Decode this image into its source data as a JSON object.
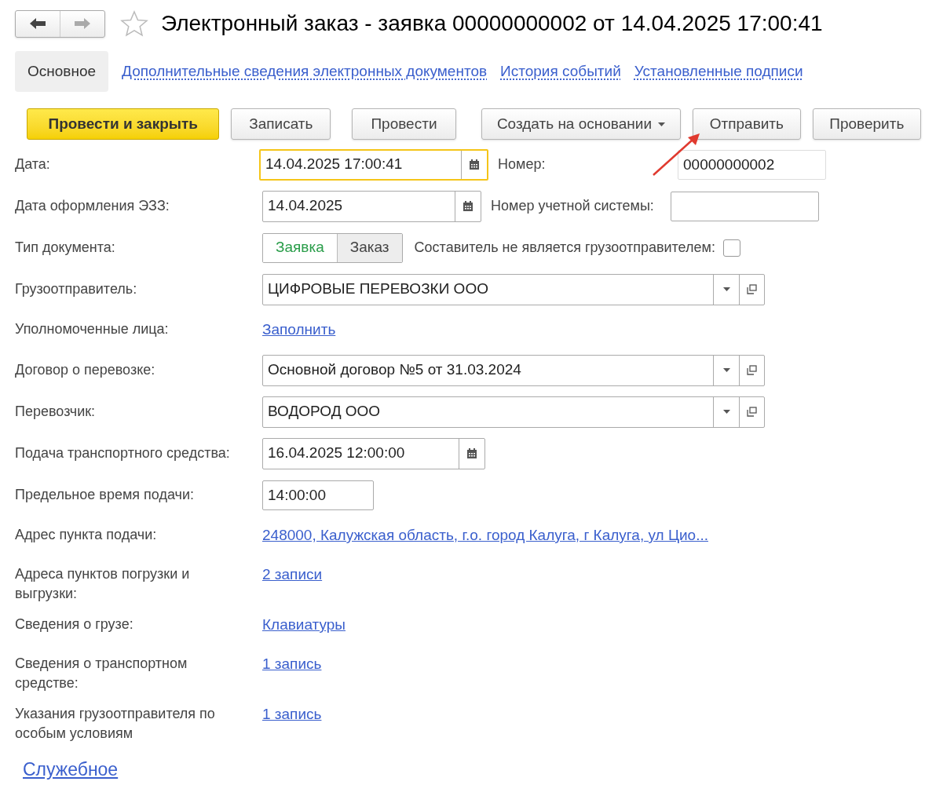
{
  "window": {
    "title": "Электронный заказ - заявка 00000000002 от 14.04.2025 17:00:41",
    "favorite": false
  },
  "tabs": [
    {
      "label": "Основное",
      "selected": true
    },
    {
      "label": "Дополнительные сведения электронных документов",
      "selected": false
    },
    {
      "label": "История событий",
      "selected": false
    },
    {
      "label": "Установленные подписи",
      "selected": false
    }
  ],
  "toolbar": [
    {
      "label": "Провести и закрыть",
      "kind": "primary"
    },
    {
      "label": "Записать",
      "kind": "plain"
    },
    {
      "label": "Провести",
      "kind": "plain"
    },
    {
      "label": "Создать на основании",
      "kind": "dropdown"
    },
    {
      "label": "Отправить",
      "kind": "plain"
    },
    {
      "label": "Проверить",
      "kind": "plain"
    }
  ],
  "fields": [
    {
      "kind": "date",
      "label": "Дата:",
      "value": "14.04.2025 17:00:41",
      "focused": true,
      "extra": {
        "label": "Номер:",
        "value": "00000000002"
      }
    },
    {
      "kind": "date",
      "label": "Дата оформления ЭЗЗ:",
      "value": "14.04.2025",
      "focused": false,
      "extra": {
        "label": "Номер учетной системы:"
      }
    },
    {
      "kind": "toggle",
      "label": "Тип документа:",
      "options": [
        {
          "label": "Заявка",
          "selected": true
        },
        {
          "label": "Заказ",
          "selected": false
        }
      ],
      "check": {
        "label": "Составитель не является грузоотправителем:",
        "checked": false
      }
    },
    {
      "kind": "select",
      "label": "Грузоотправитель:",
      "value": "ЦИФРОВЫЕ ПЕРЕВОЗКИ ООО"
    },
    {
      "kind": "link",
      "label": "Уполномоченные лица:",
      "value": "Заполнить"
    },
    {
      "kind": "select",
      "label": "Договор о перевозке:",
      "value": "Основной договор №5 от 31.03.2024"
    },
    {
      "kind": "select",
      "label": "Перевозчик:",
      "value": "ВОДОРОД ООО"
    },
    {
      "kind": "date",
      "label": "Подача транспортного средства:",
      "value": "16.04.2025 12:00:00",
      "focused": false
    },
    {
      "kind": "time",
      "label": "Предельное время подачи:",
      "value": "14:00:00"
    },
    {
      "kind": "link",
      "label": "Адрес пункта подачи:",
      "value": "248000, Калужская область, г.о. город Калуга, г Калуга, ул Цио..."
    },
    {
      "kind": "link",
      "label": "Адреса пунктов погрузки и выгрузки:",
      "value": "2 записи"
    },
    {
      "kind": "link",
      "label": "Сведения о грузе:",
      "value": "Клавиатуры"
    },
    {
      "kind": "link",
      "label": "Сведения о транспортном средстве:",
      "value": "1 запись"
    },
    {
      "kind": "link",
      "label": "Указания грузоотправителя по особым условиям",
      "value": "1 запись"
    }
  ],
  "footer_link": "Служебное"
}
